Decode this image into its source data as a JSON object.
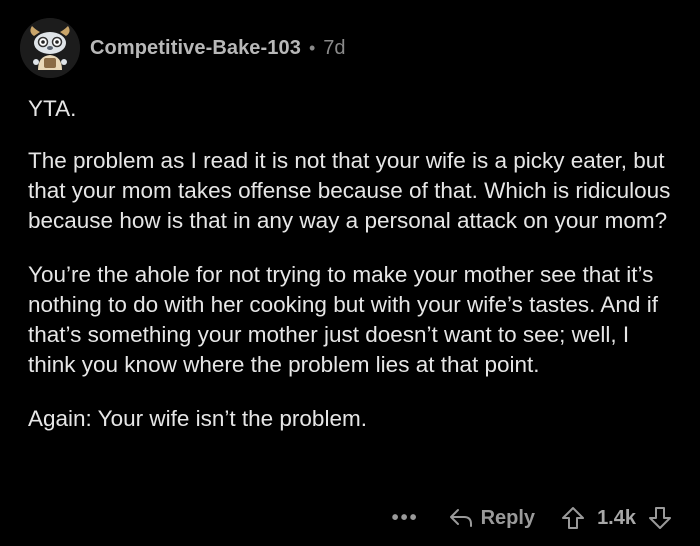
{
  "comment": {
    "username": "Competitive-Bake-103",
    "separator": "•",
    "age": "7d",
    "paragraphs": [
      "YTA.",
      "The problem as I read it is not that your wife is a picky eater, but that your mom takes offense because of that. Which is ridiculous because how is that in any way a personal attack on your mom?",
      "You’re the ahole for not trying to make your mother see that it’s nothing to do with her cooking but with your wife’s tastes. And if that’s something your mother just doesn’t want to see; well, I think you know where the problem lies at that point.",
      "Again: Your wife isn’t the problem."
    ]
  },
  "actions": {
    "more_label": "•••",
    "reply_label": "Reply",
    "score": "1.4k",
    "icons": {
      "reply": "reply-arrow-icon",
      "upvote": "upvote-arrow-icon",
      "downvote": "downvote-arrow-icon",
      "avatar": "snoo-avatar"
    }
  },
  "colors": {
    "background": "#000000",
    "text": "#e6e6e6",
    "muted": "#9a9a9a",
    "username": "#b8b8b8"
  }
}
